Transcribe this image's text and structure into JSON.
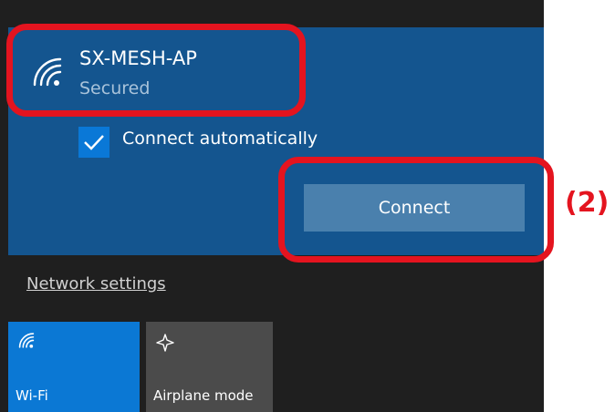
{
  "network": {
    "ssid": "SX-MESH-AP",
    "security": "Secured",
    "connect_automatically_label": "Connect automatically",
    "connect_automatically_checked": true,
    "connect_button_label": "Connect"
  },
  "links": {
    "network_settings": "Network settings"
  },
  "quick_actions": {
    "wifi_label": "Wi-Fi",
    "airplane_label": "Airplane mode"
  },
  "annotation": {
    "step_label": "(2)"
  },
  "colors": {
    "accent": "#0b78d4",
    "selected_bg": "#14558f",
    "panel_bg": "#1f1f1f",
    "highlight": "#e4141f"
  },
  "icons": {
    "network": "wifi-signal-icon",
    "checkbox": "checkmark-icon",
    "airplane": "airplane-icon"
  }
}
